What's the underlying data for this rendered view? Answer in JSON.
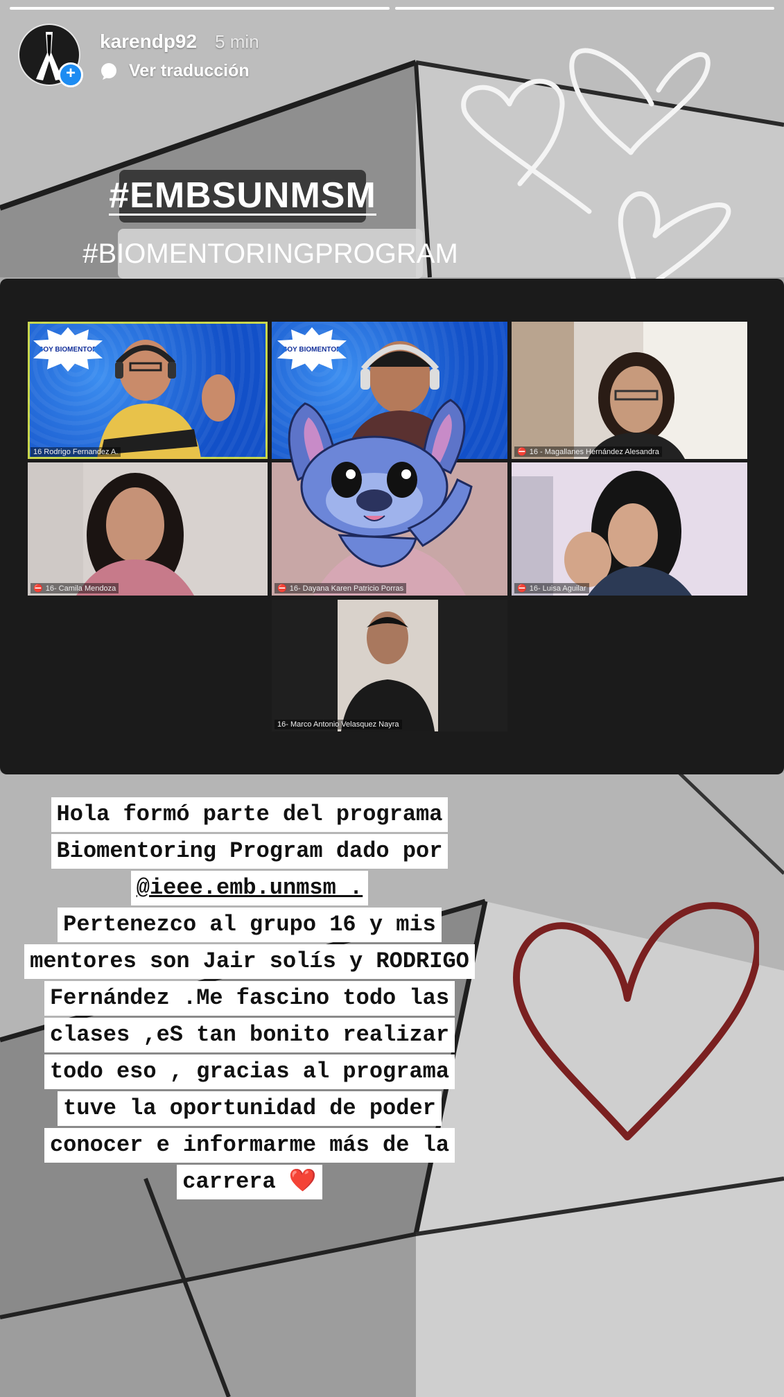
{
  "story": {
    "progress": [
      1.0,
      1.0
    ],
    "username": "karendp92",
    "time": "5 min",
    "translate_label": "Ver traducción"
  },
  "stickers": {
    "hashtag_1": "#EMBSUNMSM",
    "hashtag_2": "#BIOMENTORINGPROGRAM"
  },
  "meeting": {
    "badge_text": "SOY BIOMENTOR",
    "participants": [
      {
        "name": "16 Rodrigo Fernandez A."
      },
      {
        "name": ""
      },
      {
        "name": "16 - Magallanes Hernández Alesandra"
      },
      {
        "name": "16- Camila Mendoza"
      },
      {
        "name": "16- Dayana Karen Patricio Porras"
      },
      {
        "name": "16- Luisa Aguilar"
      },
      {
        "name": "16- Marco Antonio Velasquez Nayra"
      }
    ]
  },
  "message": {
    "lines": [
      "Hola formó parte del programa",
      "Biomentoring Program dado por",
      "@ieee.emb.unmsm .",
      "Pertenezco al grupo 16 y mis",
      "mentores son Jair solís y RODRIGO",
      "Fernández .Me fascino todo las",
      "clases ,eS tan bonito realizar",
      "todo eso , gracias al programa",
      "tuve la oportunidad de poder",
      "conocer e informarme más de la",
      "carrera ❤️"
    ]
  },
  "colors": {
    "progress_fill": "#ffffff",
    "heart_red": "#7a2020",
    "add_badge": "#1d8cf2",
    "active_speaker": "#c8d64a"
  }
}
